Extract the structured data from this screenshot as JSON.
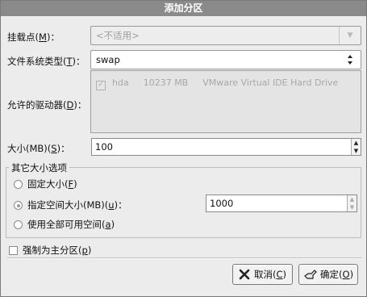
{
  "window": {
    "title": "添加分区"
  },
  "mount_point": {
    "label": "挂载点",
    "accel": "M",
    "label_suffix": "：",
    "value": "<不适用>"
  },
  "fs_type": {
    "label": "文件系统类型",
    "accel": "T",
    "label_suffix": "：",
    "value": "swap"
  },
  "drives": {
    "label": "允许的驱动器",
    "accel": "D",
    "label_suffix": "：",
    "rows": [
      {
        "checked": true,
        "name": "hda",
        "size": "10237 MB",
        "model": "VMware Virtual IDE Hard Drive"
      }
    ]
  },
  "size": {
    "label": "大小(MB)",
    "accel": "S",
    "label_suffix": "：",
    "value": "100"
  },
  "size_options": {
    "title": "其它大小选项",
    "fixed": {
      "label": "固定大小",
      "accel": "F"
    },
    "up_to": {
      "label": "指定空间大小(MB)",
      "accel": "u",
      "label_suffix": "：",
      "value": "1000"
    },
    "fill": {
      "label": "使用全部可用空间",
      "accel": "a"
    },
    "selected": "up_to"
  },
  "force_primary": {
    "label": "强制为主分区",
    "accel": "p",
    "checked": false
  },
  "buttons": {
    "cancel": {
      "label": "取消",
      "accel": "C"
    },
    "ok": {
      "label": "确定",
      "accel": "O"
    }
  }
}
